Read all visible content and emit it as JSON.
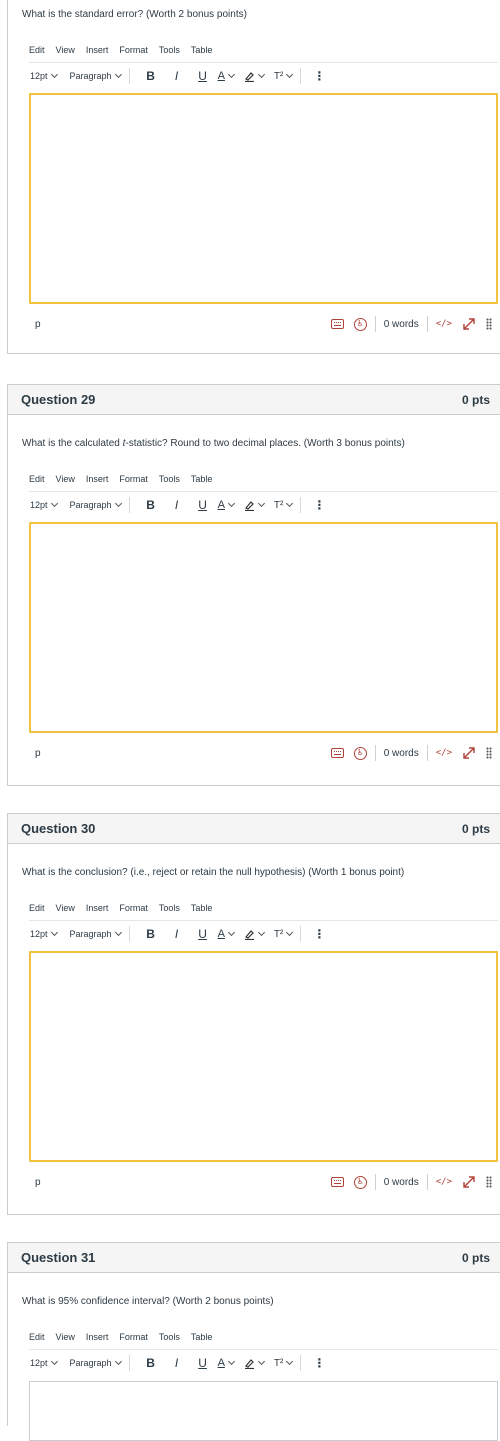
{
  "menu": [
    "Edit",
    "View",
    "Insert",
    "Format",
    "Tools",
    "Table"
  ],
  "toolbar": {
    "font_size": "12pt",
    "block_format": "Paragraph",
    "bold": "B",
    "italic": "I",
    "underline": "U",
    "text_color": "A",
    "superscript": "T²",
    "more": "⋮"
  },
  "status": {
    "element_path": "p",
    "word_count": "0 words",
    "html_editor": "</>"
  },
  "q28": {
    "text": "What is the standard error? (Worth 2 bonus points)"
  },
  "q29": {
    "title": "Question 29",
    "points": "0 pts",
    "text_before": "What is the calculated ",
    "text_em": "t",
    "text_after": "-statistic? Round to two decimal places. (Worth 3 bonus points)"
  },
  "q30": {
    "title": "Question 30",
    "points": "0 pts",
    "text": "What is the conclusion? (i.e., reject or retain the null hypothesis) (Worth 1 bonus point)"
  },
  "q31": {
    "title": "Question 31",
    "points": "0 pts",
    "text": "What is 95% confidence interval? (Worth 2 bonus points)"
  },
  "colors": {
    "accent": "#b0433a",
    "focus_border": "#f1c23e",
    "header_bg": "#f5f5f5",
    "border": "#c7cdd1"
  }
}
